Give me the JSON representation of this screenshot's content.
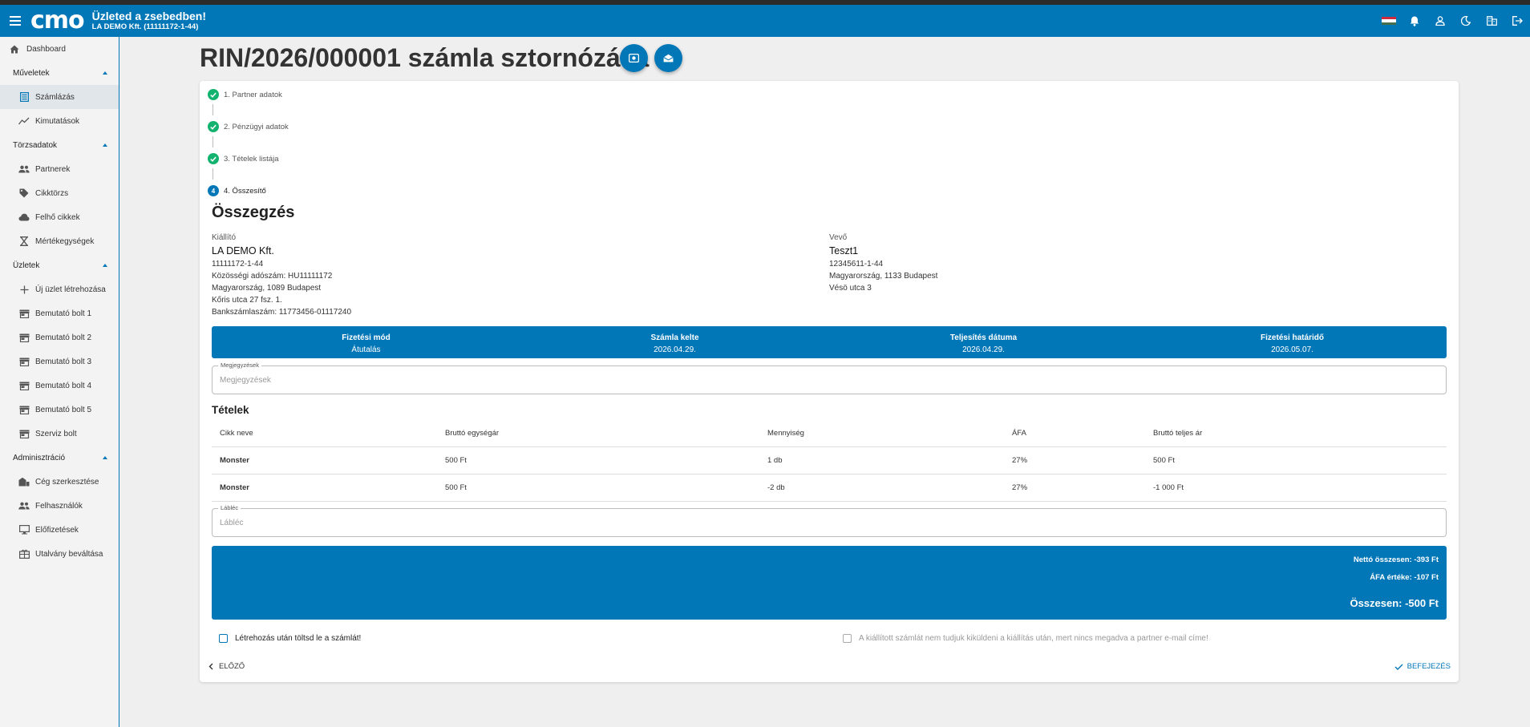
{
  "topbar": {
    "logo": "cmo",
    "tagline": "Üzleted a zsebedben!",
    "company": "LA DEMO Kft. (11111172-1-44)",
    "flag_colors": [
      "#cd2a3e",
      "#ffffff",
      "#436f4d"
    ]
  },
  "sidebar": {
    "dashboard": "Dashboard",
    "groups": [
      {
        "title": "Műveletek",
        "items": [
          "Számlázás",
          "Kimutatások"
        ]
      },
      {
        "title": "Törzsadatok",
        "items": [
          "Partnerek",
          "Cikktörzs",
          "Felhő cikkek",
          "Mértékegységek"
        ]
      },
      {
        "title": "Üzletek",
        "items": [
          "Új üzlet létrehozása",
          "Bemutató bolt 1",
          "Bemutató bolt 2",
          "Bemutató bolt 3",
          "Bemutató bolt 4",
          "Bemutató bolt 5",
          "Szerviz bolt"
        ]
      },
      {
        "title": "Adminisztráció",
        "items": [
          "Cég szerkesztése",
          "Felhasználók",
          "Előfizetések",
          "Utalvány beváltása"
        ]
      }
    ]
  },
  "page": {
    "title": "RIN/2026/000001 számla sztornózása"
  },
  "steps": [
    "1. Partner adatok",
    "2. Pénzügyi adatok",
    "3. Tételek listája",
    "4. Összesítő"
  ],
  "step_current_number": "4",
  "summary": {
    "title": "Összegzés",
    "issuer": {
      "label": "Kiállító",
      "name": "LA DEMO Kft.",
      "tax": "11111172-1-44",
      "eu_tax": "Közösségi adószám: HU11111172",
      "city": "Magyarország, 1089 Budapest",
      "street": "Kőris utca 27 fsz. 1.",
      "bank": "Bankszámlaszám: 11773456-01117240"
    },
    "buyer": {
      "label": "Vevő",
      "name": "Teszt1",
      "tax": "12345611-1-44",
      "city": "Magyarország, 1133 Budapest",
      "street": "Vésö utca 3"
    }
  },
  "info": [
    {
      "label": "Fizetési mód",
      "value": "Átutalás"
    },
    {
      "label": "Számla kelte",
      "value": "2026.04.29."
    },
    {
      "label": "Teljesítés dátuma",
      "value": "2026.04.29."
    },
    {
      "label": "Fizetési határidő",
      "value": "2026.05.07."
    }
  ],
  "notes": {
    "label": "Megjegyzések",
    "placeholder": "Megjegyzések"
  },
  "items": {
    "title": "Tételek",
    "headers": [
      "Cikk neve",
      "Bruttó egységár",
      "Mennyiség",
      "ÁFA",
      "Bruttó teljes ár"
    ],
    "rows": [
      [
        "Monster",
        "500 Ft",
        "1 db",
        "27%",
        "500 Ft"
      ],
      [
        "Monster",
        "500 Ft",
        "-2 db",
        "27%",
        "-1 000 Ft"
      ]
    ]
  },
  "footer_field": {
    "label": "Lábléc",
    "placeholder": "Lábléc"
  },
  "totals": {
    "net": "Nettó összesen: -393 Ft",
    "vat": "ÁFA értéke: -107 Ft",
    "total": "Összesen: -500 Ft"
  },
  "options": {
    "download": "Létrehozás után töltsd le a számlát!",
    "email_disabled": "A kiállított számlát nem tudjuk kiküldeni a kiállítás után, mert nincs megadva a partner e-mail címe!"
  },
  "nav": {
    "prev": "ELŐZŐ",
    "finish": "BEFEJEZÉS"
  },
  "colors": {
    "primary": "#0277b8",
    "success": "#13b36f"
  }
}
